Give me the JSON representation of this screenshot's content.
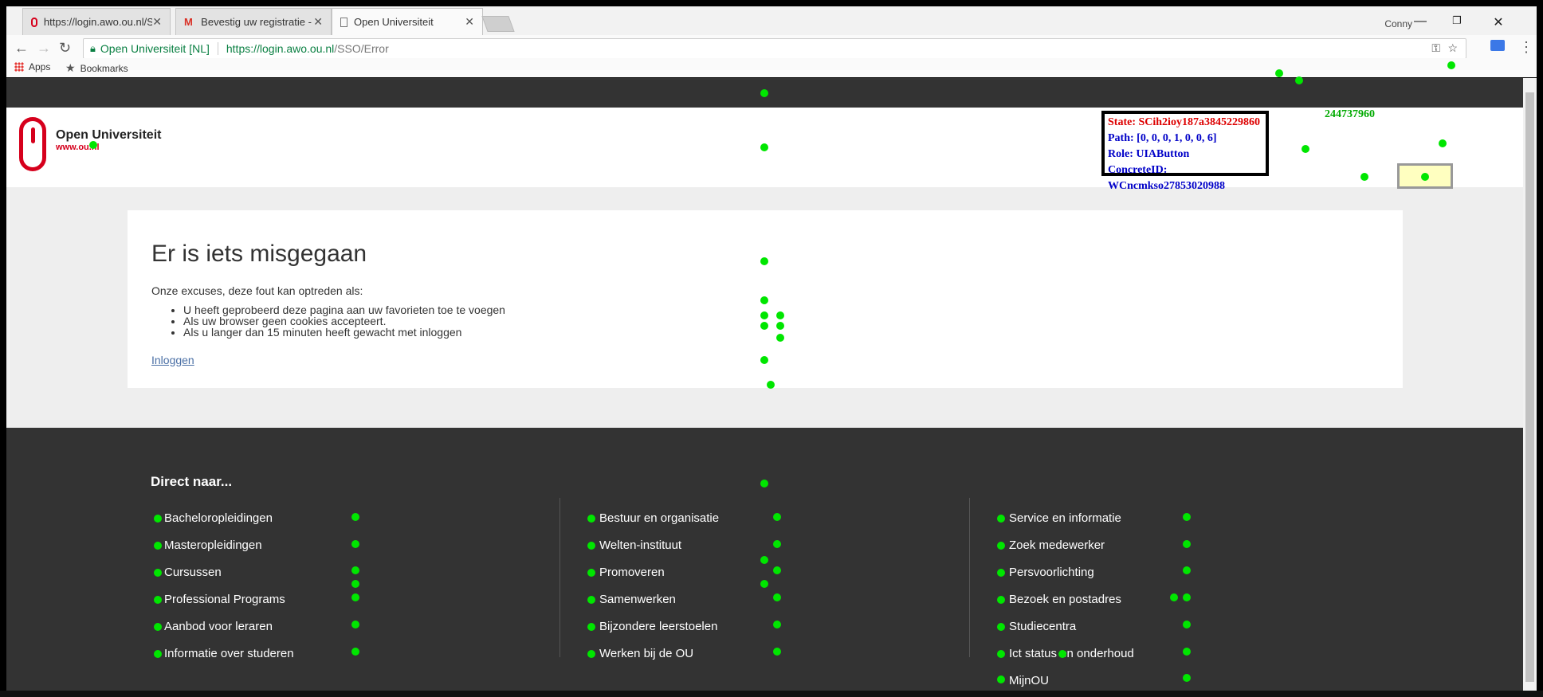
{
  "browser": {
    "tabs": [
      {
        "title": "https://login.awo.ou.nl/S",
        "icon": "ou-favicon-icon",
        "active": false
      },
      {
        "title": "Bevestig uw registratie -",
        "icon": "gmail-icon",
        "active": false
      },
      {
        "title": "Open Universiteit",
        "icon": "page-icon",
        "active": true
      }
    ],
    "user": "Conny",
    "secure_label": "Open Universiteit [NL]",
    "url_host": "https://login.awo.ou.nl",
    "url_path": "/SSO/Error",
    "bookmarks": [
      {
        "label": "Apps",
        "icon": "apps-icon"
      },
      {
        "label": "Bookmarks",
        "icon": "star-icon"
      }
    ]
  },
  "header": {
    "logo_name": "Open Universiteit",
    "logo_url": "www.ou.nl"
  },
  "debug_overlay": {
    "state": "State: SCih2ioy187a3845229860",
    "path": "Path: [0, 0, 0, 1, 0, 0, 6]",
    "role": "Role: UIAButton",
    "concrete_id": "ConcreteID: WCncmkso27853020988",
    "number": "244737960"
  },
  "error": {
    "title": "Er is iets misgegaan",
    "intro": "Onze excuses, deze fout kan optreden als:",
    "reasons": [
      "U heeft geprobeerd deze pagina aan uw favorieten toe te voegen",
      "Als uw browser geen cookies accepteert.",
      "Als u langer dan 15 minuten heeft gewacht met inloggen"
    ],
    "login_link": "Inloggen"
  },
  "footer": {
    "heading": "Direct naar...",
    "col1": [
      "Bacheloropleidingen",
      "Masteropleidingen",
      "Cursussen",
      "Professional Programs",
      "Aanbod voor leraren",
      "Informatie over studeren"
    ],
    "col2": [
      "Bestuur en organisatie",
      "Welten-instituut",
      "Promoveren",
      "Samenwerken",
      "Bijzondere leerstoelen",
      "Werken bij de OU"
    ],
    "col3": [
      "Service en informatie",
      "Zoek medewerker",
      "Persvoorlichting",
      "Bezoek en postadres",
      "Studiecentra",
      "Ict status en onderhoud",
      "MijnOU"
    ]
  },
  "colors": {
    "brand_red": "#d6001c",
    "dark_band": "#333333",
    "marker_green": "#00e600"
  }
}
